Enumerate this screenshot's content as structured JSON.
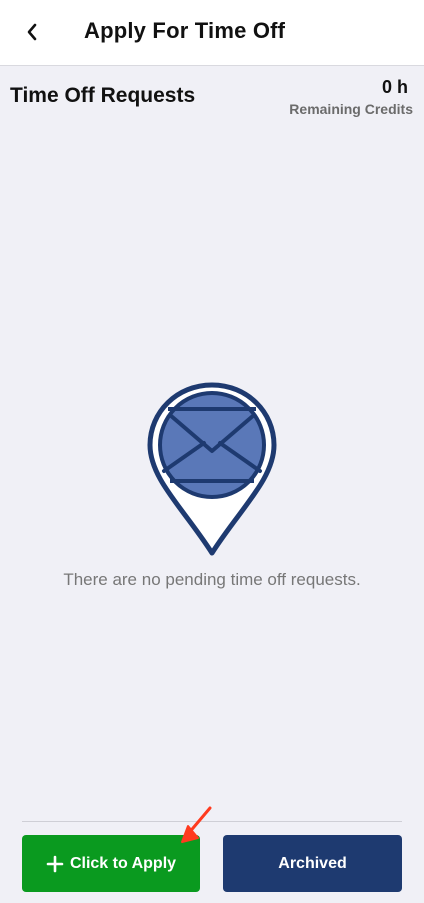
{
  "header": {
    "title": "Apply For Time Off",
    "back_icon": "chevron-left-icon"
  },
  "summary": {
    "section_title": "Time Off Requests",
    "credits_value": "0 h",
    "credits_label": "Remaining Credits"
  },
  "empty_state": {
    "icon": "map-pin-envelope-icon",
    "message": "There are no pending time off requests."
  },
  "actions": {
    "apply_label": "Click to Apply",
    "apply_icon": "plus-icon",
    "archived_label": "Archived"
  },
  "colors": {
    "apply_button": "#0a9a1f",
    "archived_button": "#1e3a70",
    "pin_outline": "#1e3a70",
    "envelope_fill": "#5a78b8",
    "annotation_arrow": "#ff3b1f"
  }
}
